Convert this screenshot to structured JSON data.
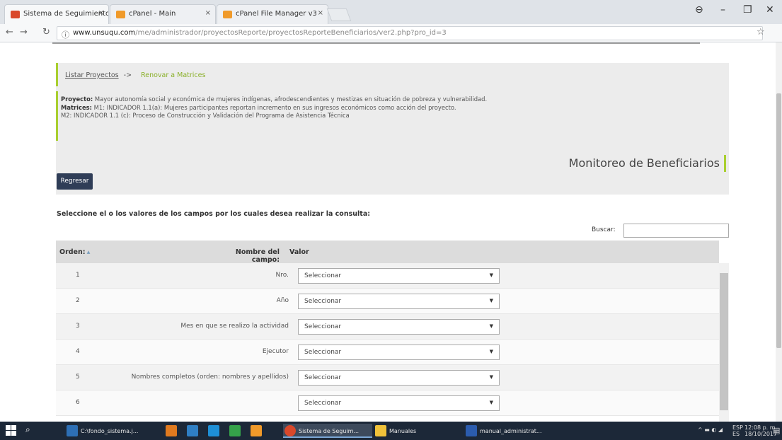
{
  "browser": {
    "tabs": [
      {
        "title": "Sistema de Seguimiento",
        "favicon_color": "#d9482b"
      },
      {
        "title": "cPanel - Main",
        "favicon_color": "#f09a2a"
      },
      {
        "title": "cPanel File Manager v3",
        "favicon_color": "#f09a2a"
      }
    ],
    "tab_close": "×",
    "url_host": "www.unsuqu.com",
    "url_path": "/me/administrador/proyectosReporte/proyectosReporteBeneficiarios/ver2.php?pro_id=3",
    "win_min": "–",
    "win_max": "❐",
    "win_close": "✕",
    "account_icon": "⊖"
  },
  "breadcrumb": {
    "list_link": "Listar Proyectos",
    "arrow": "->",
    "current": "Renovar a Matrices"
  },
  "info": {
    "project_label": "Proyecto:",
    "project_text": "Mayor autonomía social y económica de mujeres indígenas, afrodescendientes y mestizas en situación de pobreza y vulnerabilidad.",
    "matrices_label": "Matrices:",
    "matrices_text": "M1: INDICADOR 1.1(a): Mujeres participantes reportan incremento en sus ingresos económicos como acción del proyecto.",
    "m2_text": "M2: INDICADOR 1.1 (c): Proceso de Construcción y Validación del Programa de Asistencia Técnica"
  },
  "page_title": "Monitoreo de Beneficiarios",
  "regresar_label": "Regresar",
  "instruction": "Seleccione el o los valores de los campos por los cuales desea realizar la consulta:",
  "search": {
    "label": "Buscar:",
    "value": ""
  },
  "table": {
    "headers": {
      "orden": "Orden:",
      "nombre": "Nombre del campo:",
      "valor": "Valor"
    },
    "rows": [
      {
        "orden": "1",
        "campo": "Nro.",
        "valor": "Seleccionar"
      },
      {
        "orden": "2",
        "campo": "Año",
        "valor": "Seleccionar"
      },
      {
        "orden": "3",
        "campo": "Mes en que se realizo la actividad",
        "valor": "Seleccionar"
      },
      {
        "orden": "4",
        "campo": "Ejecutor",
        "valor": "Seleccionar"
      },
      {
        "orden": "5",
        "campo": "Nombres completos (orden: nombres y apellidos)",
        "valor": "Seleccionar"
      },
      {
        "orden": "6",
        "campo": "",
        "valor": "Seleccionar"
      }
    ]
  },
  "taskbar": {
    "items": [
      {
        "label": "C:\\fondo_sistema.j...",
        "color": "#2d6fb5"
      },
      {
        "label": "",
        "color": "#e07a1f"
      },
      {
        "label": "",
        "color": "#2f7fc4"
      },
      {
        "label": "",
        "color": "#1e8fd6"
      },
      {
        "label": "",
        "color": "#35a24a"
      },
      {
        "label": "",
        "color": "#f09a2a"
      },
      {
        "label": "Sistema de Seguim...",
        "color": "#d9482b"
      },
      {
        "label": "Manuales",
        "color": "#f0c23a"
      },
      {
        "label": "manual_administrat...",
        "color": "#2b5cae"
      }
    ],
    "lang": "ESP",
    "lang2": "ES",
    "time": "12:08 p. m.",
    "date": "18/10/2017"
  }
}
